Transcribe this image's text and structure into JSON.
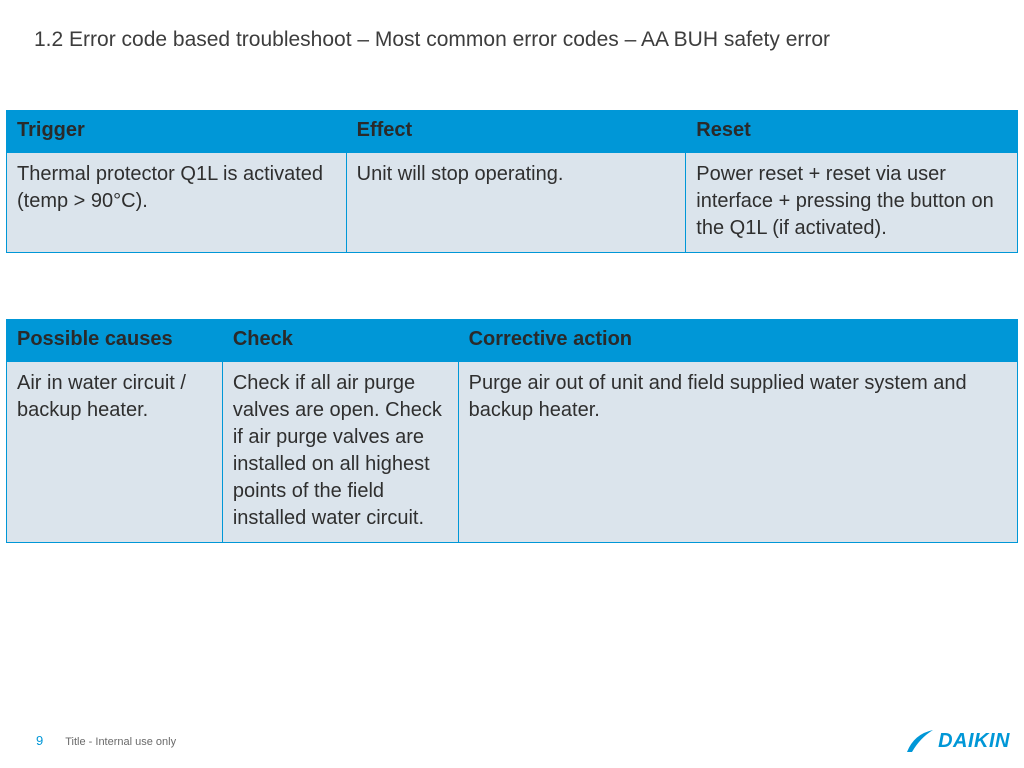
{
  "title": "1.2 Error code based troubleshoot –  Most common error codes – AA BUH safety error",
  "table1": {
    "headers": {
      "trigger": "Trigger",
      "effect": "Effect",
      "reset": "Reset"
    },
    "row": {
      "trigger": "Thermal protector Q1L is activated (temp\n> 90°C).",
      "effect": "Unit will stop operating.",
      "reset": "Power reset + reset via user interface +\npressing the button on the Q1L (if\nactivated)."
    }
  },
  "table2": {
    "headers": {
      "cause": "Possible causes",
      "check": "Check",
      "action": "Corrective action"
    },
    "row": {
      "cause": "Air in water circuit / backup heater.",
      "check": "Check if all air purge valves are open.\nCheck if air purge valves are installed on\nall highest points of the field installed water circuit.",
      "action": "Purge air out of unit and field supplied water system and backup heater."
    }
  },
  "footer": {
    "page": "9",
    "text": "Title - Internal use only"
  },
  "logo": {
    "text": "DAIKIN"
  }
}
